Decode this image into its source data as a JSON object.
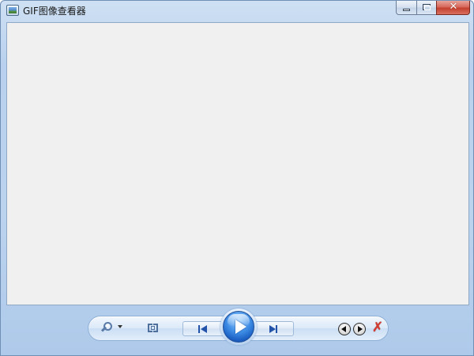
{
  "window": {
    "title": "GIF图像查看器",
    "icon": "image-viewer-app-icon"
  },
  "caption_buttons": {
    "minimize_icon": "minimize-icon",
    "maximize_icon": "maximize-icon",
    "close_icon": "close-icon",
    "close_glyph": "✕",
    "close_color": "#c3402f"
  },
  "viewport": {
    "background": "#f0f0f0"
  },
  "controls": {
    "zoom_icon": "zoom-magnifier-icon",
    "fit_icon": "actual-size-icon",
    "prev_icon": "previous-icon",
    "play_icon": "play-icon",
    "next_icon": "next-icon",
    "rotate_left_icon": "rotate-counterclockwise-icon",
    "rotate_right_icon": "rotate-clockwise-icon",
    "delete_icon": "delete-icon",
    "delete_glyph": "✗",
    "accent_color": "#1b5fc2",
    "delete_color": "#d43a2f"
  }
}
